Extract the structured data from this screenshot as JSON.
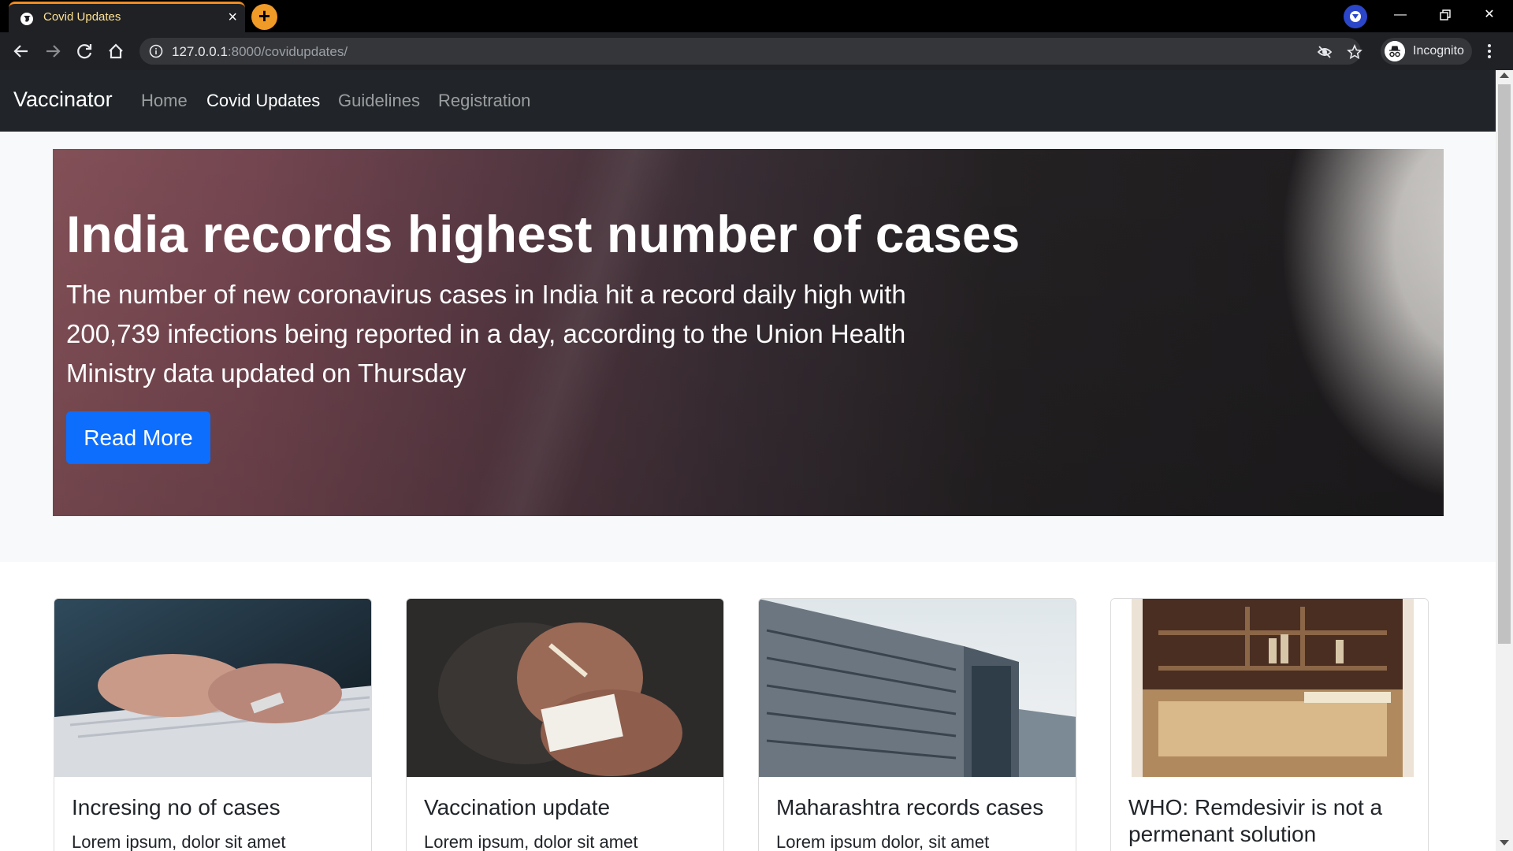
{
  "browser": {
    "tab_title": "Covid Updates",
    "url_host": "127.0.0.1",
    "url_rest": ":8000/covidupdates/",
    "profile_label": "Incognito",
    "accent_color": "#f28b21"
  },
  "navbar": {
    "brand": "Vaccinator",
    "links": [
      {
        "label": "Home",
        "active": false
      },
      {
        "label": "Covid Updates",
        "active": true
      },
      {
        "label": "Guidelines",
        "active": false
      },
      {
        "label": "Registration",
        "active": false
      }
    ]
  },
  "hero": {
    "title": "India records highest number of cases",
    "text": "The number of new coronavirus cases in India hit a record daily high with 200,739 infections being reported in a day, according to the Union Health Ministry data updated on Thursday",
    "button_label": "Read More",
    "button_color": "#0d6efd"
  },
  "cards": [
    {
      "title": "Incresing no of cases",
      "text": "Lorem ipsum, dolor sit amet",
      "image": "hands-typing-on-keyboard"
    },
    {
      "title": "Vaccination update",
      "text": "Lorem ipsum, dolor sit amet",
      "image": "hands-holding-cigarette-pack"
    },
    {
      "title": "Maharashtra records cases",
      "text": "Lorem ipsum dolor, sit amet",
      "image": "hospital-building"
    },
    {
      "title": "WHO: Remdesivir is not a permenant solution",
      "text": "",
      "image": "ice-cream-shop-interior"
    }
  ]
}
